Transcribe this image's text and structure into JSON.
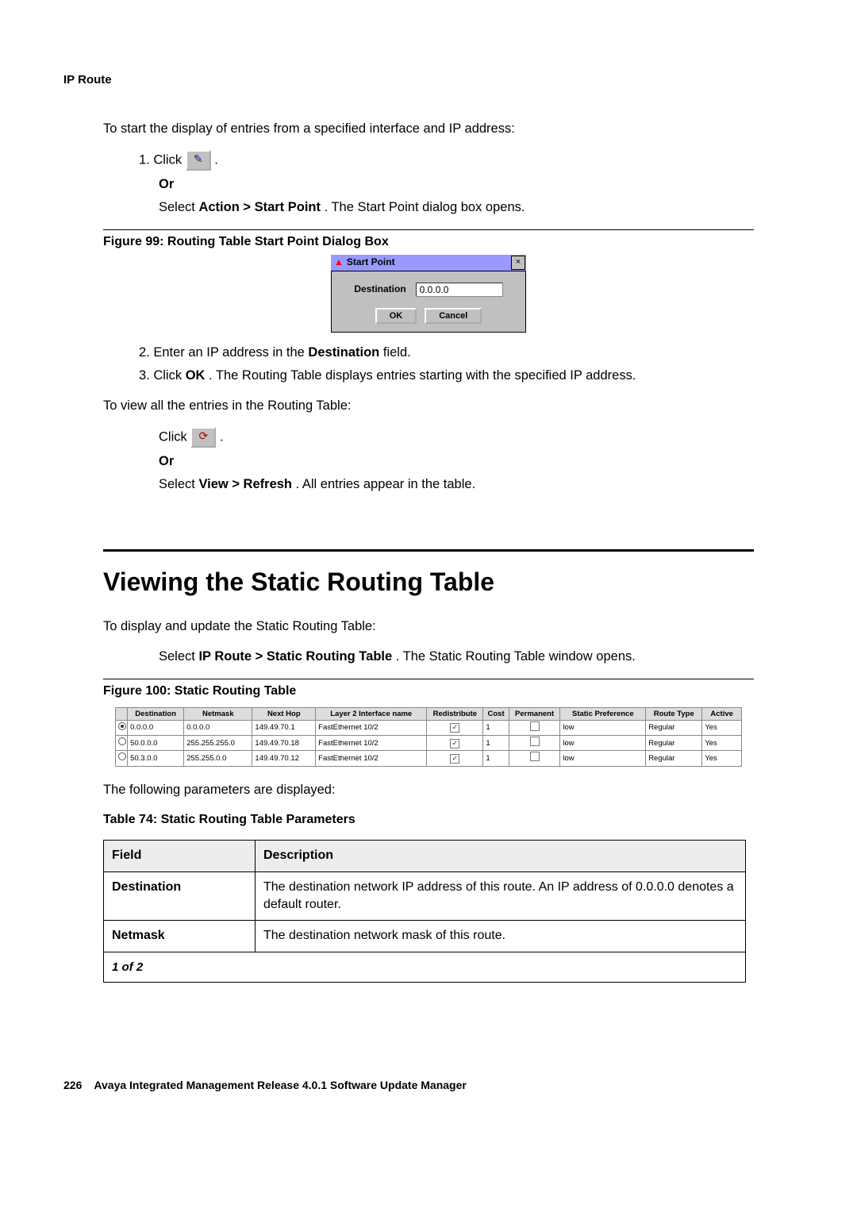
{
  "header": {
    "section": "IP Route"
  },
  "intro1": "To start the display of entries from a specified interface and IP address:",
  "steps1": {
    "s1_prefix": "1. Click ",
    "s1_suffix": " .",
    "or": "Or",
    "s1b_prefix": "Select ",
    "s1b_bold": "Action > Start Point",
    "s1b_suffix": ". The Start Point dialog box opens."
  },
  "figure99": {
    "caption": "Figure 99: Routing Table Start Point Dialog Box",
    "dialog_title": "Start Point",
    "dest_label": "Destination",
    "dest_value": "0.0.0.0",
    "ok": "OK",
    "cancel": "Cancel"
  },
  "steps2": {
    "s2_prefix": "2. Enter an IP address in the ",
    "s2_bold": "Destination",
    "s2_suffix": " field.",
    "s3_prefix": "3. Click ",
    "s3_bold": "OK",
    "s3_suffix": ". The Routing Table displays entries starting with the specified IP address."
  },
  "intro2": "To view all the entries in the Routing Table:",
  "steps3": {
    "s_prefix": "Click ",
    "s_suffix": " .",
    "or": "Or",
    "sb_prefix": "Select ",
    "sb_bold": "View > Refresh",
    "sb_suffix": ". All entries appear in the table."
  },
  "h1": "Viewing the Static Routing Table",
  "intro3": "To display and update the Static Routing Table:",
  "step_nav_prefix": "Select ",
  "step_nav_bold": "IP Route > Static Routing Table",
  "step_nav_suffix": ". The Static Routing Table window opens.",
  "figure100": {
    "caption": "Figure 100: Static Routing Table",
    "headers": [
      "",
      "Destination",
      "Netmask",
      "Next Hop",
      "Layer 2 Interface name",
      "Redistribute",
      "Cost",
      "Permanent",
      "Static Preference",
      "Route Type",
      "Active"
    ],
    "rows": [
      {
        "sel": true,
        "dest": "0.0.0.0",
        "mask": "0.0.0.0",
        "hop": "149.49.70.1",
        "if": "FastEthernet 10/2",
        "redis": true,
        "cost": "1",
        "perm": false,
        "pref": "low",
        "type": "Regular",
        "active": "Yes"
      },
      {
        "sel": false,
        "dest": "50.0.0.0",
        "mask": "255.255.255.0",
        "hop": "149.49.70.18",
        "if": "FastEthernet 10/2",
        "redis": true,
        "cost": "1",
        "perm": false,
        "pref": "low",
        "type": "Regular",
        "active": "Yes"
      },
      {
        "sel": false,
        "dest": "50.3.0.0",
        "mask": "255.255.0.0",
        "hop": "149.49.70.12",
        "if": "FastEthernet 10/2",
        "redis": true,
        "cost": "1",
        "perm": false,
        "pref": "low",
        "type": "Regular",
        "active": "Yes"
      }
    ]
  },
  "params_intro": "The following parameters are displayed:",
  "table74": {
    "caption": "Table 74: Static Routing Table Parameters",
    "col1": "Field",
    "col2": "Description",
    "rows": [
      {
        "field": "Destination",
        "desc": "The destination network IP address of this route. An IP address of 0.0.0.0 denotes a default router."
      },
      {
        "field": "Netmask",
        "desc": "The destination network mask of this route."
      }
    ],
    "page_of": "1 of 2"
  },
  "footer": {
    "page_number": "226",
    "product": "Avaya Integrated Management Release 4.0.1 Software Update Manager"
  }
}
